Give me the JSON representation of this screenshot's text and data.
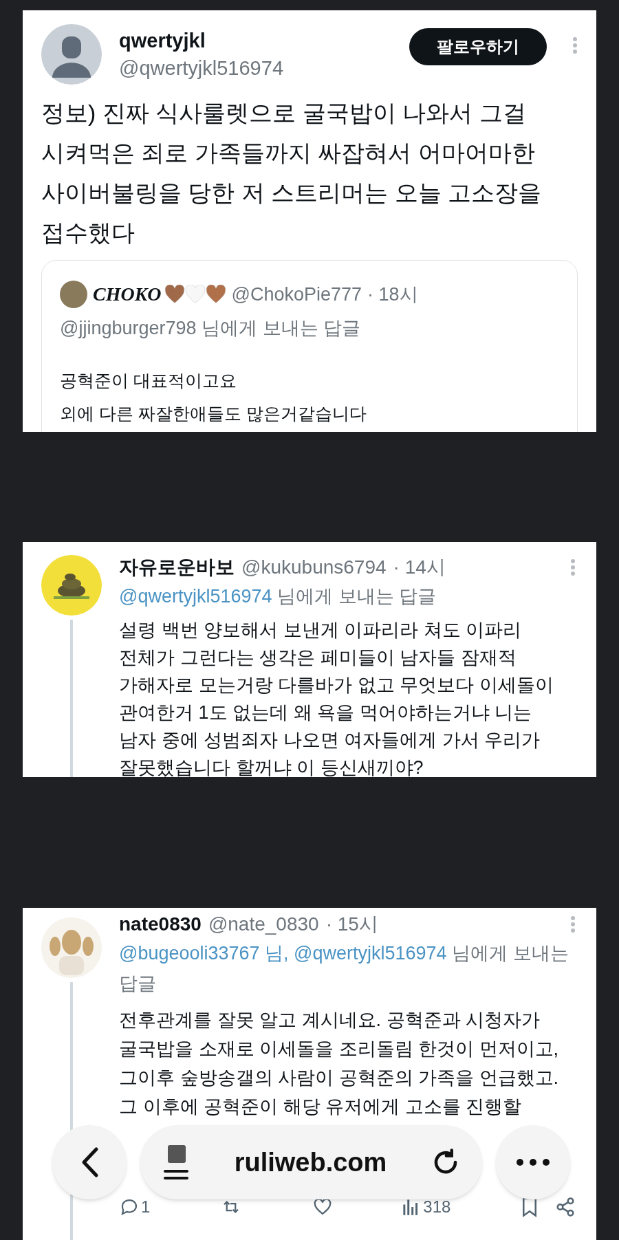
{
  "main_post": {
    "name": "qwertyjkl",
    "handle": "@qwertyjkl516974",
    "follow_button": "팔로우하기",
    "body_lines": [
      "정보) 진짜 식사룰렛으로 굴국밥이 나와서 그걸",
      "시켜먹은 죄로 가족들까지 싸잡혀서 어마어마한",
      "사이버불링을 당한 저 스트리머는 오늘 고소장을",
      "접수했다"
    ],
    "quote": {
      "name": "CHOKO",
      "handle": "@ChokoPie777",
      "time": "· 18시",
      "reply_to": "@jjingburger798 님에게 보내는 답글",
      "body_lines": [
        "공혁준이 대표적이고요",
        "외에 다른 짜잘한애들도 많은거같습니다"
      ]
    }
  },
  "replies": [
    {
      "name": "자유로운바보",
      "handle": "@kukubuns6794",
      "time": "· 14시",
      "mentions": [
        "@qwertyjkl516974"
      ],
      "reply_suffix": "님에게 보내는 답글",
      "body_lines": [
        "설령 백번 양보해서 보낸게 이파리라 쳐도 이파리",
        "전체가 그런다는 생각은 페미들이 남자들 잠재적",
        "가해자로 모는거랑 다를바가 없고 무엇보다 이세돌이",
        "관여한거 1도 없는데 왜 욕을 먹어야하는거냐 니는",
        "남자 중에 성범죄자 나오면 여자들에게 가서 우리가",
        "잘못했습니다 할꺼냐 이 등신새끼야?"
      ]
    },
    {
      "name": "nate0830",
      "handle": "@nate_0830",
      "time": "· 15시",
      "mentions": [
        "@bugeooli33767 님,",
        "@qwertyjkl516974"
      ],
      "reply_suffix": "님에게 보내는 답글",
      "body_lines": [
        "전후관계를 잘못 알고 계시네요. 공혁준과 시청자가",
        "굴국밥을 소재로 이세돌을 조리돌림 한것이 먼저이고,",
        "그이후 숲방송갤의 사람이 공혁준의 가족을 언급했고.",
        "그 이후에 공혁준이 해당 유저에게 고소를 진행할"
      ],
      "actions": {
        "reply_count": "1",
        "view_count": "318"
      }
    }
  ],
  "browser_bar": {
    "url": "ruliweb.com"
  }
}
